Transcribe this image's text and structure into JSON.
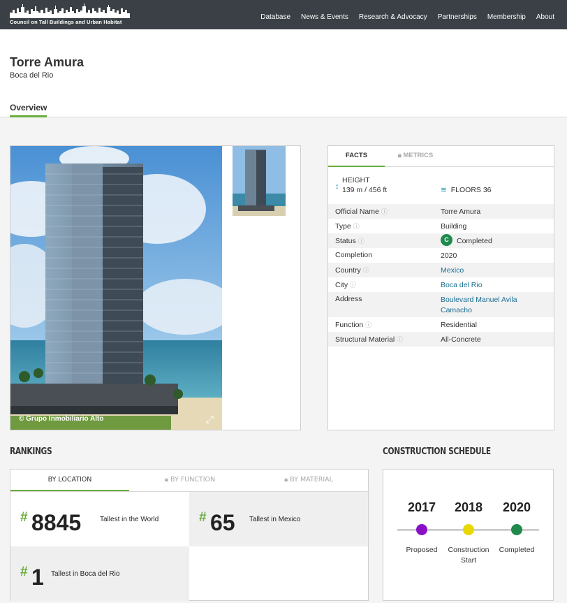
{
  "brand": {
    "logo_text": "Council on Tall Buildings and Urban Habitat"
  },
  "nav": [
    "Database",
    "News & Events",
    "Research & Advocacy",
    "Partnerships",
    "Membership",
    "About"
  ],
  "building": {
    "name": "Torre Amura",
    "city": "Boca del Rio"
  },
  "tabs": {
    "overview": "Overview"
  },
  "image": {
    "credit": "© Grupo Inmobiliario Alto",
    "expand_icon": "expand-icon"
  },
  "facts": {
    "tab_facts": "FACTS",
    "tab_metrics": "METRICS",
    "height_label": "HEIGHT",
    "height_value": "139 m / 456 ft",
    "floors_label": "FLOORS",
    "floors_value": "36",
    "rows": [
      {
        "label": "Official Name",
        "value": "Torre Amura"
      },
      {
        "label": "Type",
        "value": "Building"
      },
      {
        "label": "Status",
        "value": "Completed",
        "badge": "C"
      },
      {
        "label": "Completion",
        "value": "2020"
      },
      {
        "label": "Country",
        "value": "Mexico"
      },
      {
        "label": "City",
        "value": "Boca del Rio"
      },
      {
        "label": "Address",
        "value": "Boulevard Manuel Avila Camacho"
      },
      {
        "label": "Function",
        "value": "Residential"
      },
      {
        "label": "Structural Material",
        "value": "All-Concrete"
      }
    ]
  },
  "rankings": {
    "title": "RANKINGS",
    "tabs": [
      "BY LOCATION",
      "BY FUNCTION",
      "BY MATERIAL"
    ],
    "items": [
      {
        "number": "8845",
        "label": "Tallest in the World"
      },
      {
        "number": "65",
        "label": "Tallest in Mexico"
      },
      {
        "number": "1",
        "label": "Tallest in Boca del Rio"
      }
    ]
  },
  "schedule": {
    "title": "CONSTRUCTION SCHEDULE",
    "phases": [
      {
        "year": "2017",
        "label": "Proposed",
        "color": "#8a10c8"
      },
      {
        "year": "2018",
        "label": "Construction Start",
        "color": "#e8d800"
      },
      {
        "year": "2020",
        "label": "Completed",
        "color": "#1f8a4c"
      }
    ]
  },
  "colors": {
    "accent": "#6aac3e",
    "nav_bg": "#3a4045",
    "link": "#1a6f93"
  }
}
